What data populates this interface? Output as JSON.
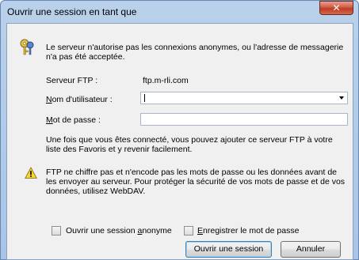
{
  "window": {
    "title": "Ouvrir une session en tant que"
  },
  "message": "Le serveur n'autorise pas les connexions anonymes, ou l'adresse de messagerie n'a pas été acceptée.",
  "server": {
    "label": "Serveur FTP :",
    "value": "ftp.m-rli.com"
  },
  "username": {
    "label_accel": "N",
    "label_rest": "om d'utilisateur :",
    "value": ""
  },
  "password": {
    "label_accel": "M",
    "label_rest": "ot de passe :",
    "value": ""
  },
  "info": "Une fois que vous êtes connecté, vous pouvez ajouter ce serveur FTP à votre liste des Favoris et y revenir facilement.",
  "warning": "FTP ne chiffre pas et n'encode pas les mots de passe ou les données avant de les envoyer au serveur. Pour protéger la sécurité de vos mots de passe et de vos données, utilisez WebDAV.",
  "anonymous": {
    "label_before": "Ouvrir une session ",
    "label_accel": "a",
    "label_after": "nonyme",
    "checked": false
  },
  "save_password": {
    "label_accel": "E",
    "label_rest": "nregistrer le mot de passe",
    "checked": false
  },
  "buttons": {
    "login": "Ouvrir une session",
    "cancel": "Annuler"
  },
  "icons": {
    "close": "close-icon",
    "keys": "keys-icon",
    "warning": "warning-icon"
  }
}
